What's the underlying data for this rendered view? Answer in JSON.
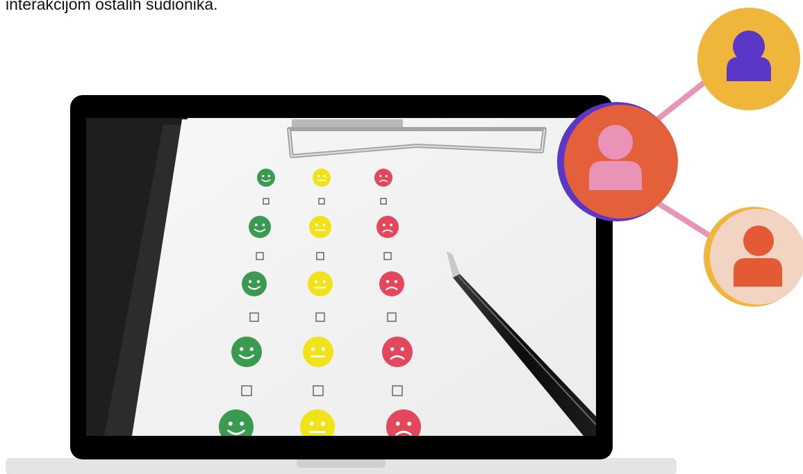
{
  "intro": {
    "text": "interakcijom ostalih sudionika."
  },
  "feedback_form": {
    "rows": [
      [
        "happy-face",
        "neutral-face",
        "sad-face"
      ],
      [
        "happy-face",
        "neutral-face",
        "sad-face"
      ],
      [
        "happy-face",
        "neutral-face",
        "sad-face"
      ],
      [
        "happy-face",
        "neutral-face",
        "sad-face"
      ],
      [
        "happy-face",
        "neutral-face",
        "sad-face"
      ]
    ],
    "colors": {
      "happy": "#3a9a50",
      "neutral": "#f2e21a",
      "sad": "#e2475c"
    }
  },
  "participants": [
    {
      "icon": "person-icon",
      "circle_color": "#f0b63c",
      "figure_color": "#5b37c8"
    },
    {
      "icon": "person-icon",
      "circle_color": "#e3603a",
      "figure_color": "#e993b6",
      "accent_color": "#5b37c8"
    },
    {
      "icon": "person-icon",
      "circle_color": "#f3d4c2",
      "figure_color": "#e45a34",
      "accent_color": "#f0b63c"
    }
  ],
  "connector_color": "#e993b6",
  "laptop": {
    "bezel_color": "#000000",
    "base_color": "#e4e4e4"
  }
}
